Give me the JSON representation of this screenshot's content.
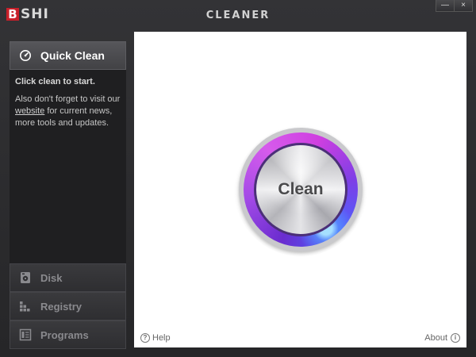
{
  "app": {
    "logo_initial": "B",
    "logo_rest": "SHI",
    "title": "CLEANER"
  },
  "window_controls": {
    "minimize": "—",
    "close": "×"
  },
  "sidebar": {
    "active": {
      "label": "Quick Clean",
      "icon": "speedometer-icon"
    },
    "panel": {
      "heading": "Click clean to start.",
      "text_before_link": "Also don't forget to visit our ",
      "link_text": "website",
      "text_after_link": " for current news, more tools and updates."
    },
    "items": [
      {
        "label": "Disk",
        "icon": "disk-icon"
      },
      {
        "label": "Registry",
        "icon": "registry-icon"
      },
      {
        "label": "Programs",
        "icon": "programs-icon"
      }
    ]
  },
  "main": {
    "clean_button": "Clean",
    "help_label": "Help",
    "about_label": "About"
  },
  "colors": {
    "brand_red": "#c8202a",
    "ring_purple": "#a24ae6",
    "ring_blue": "#4a63ff"
  }
}
